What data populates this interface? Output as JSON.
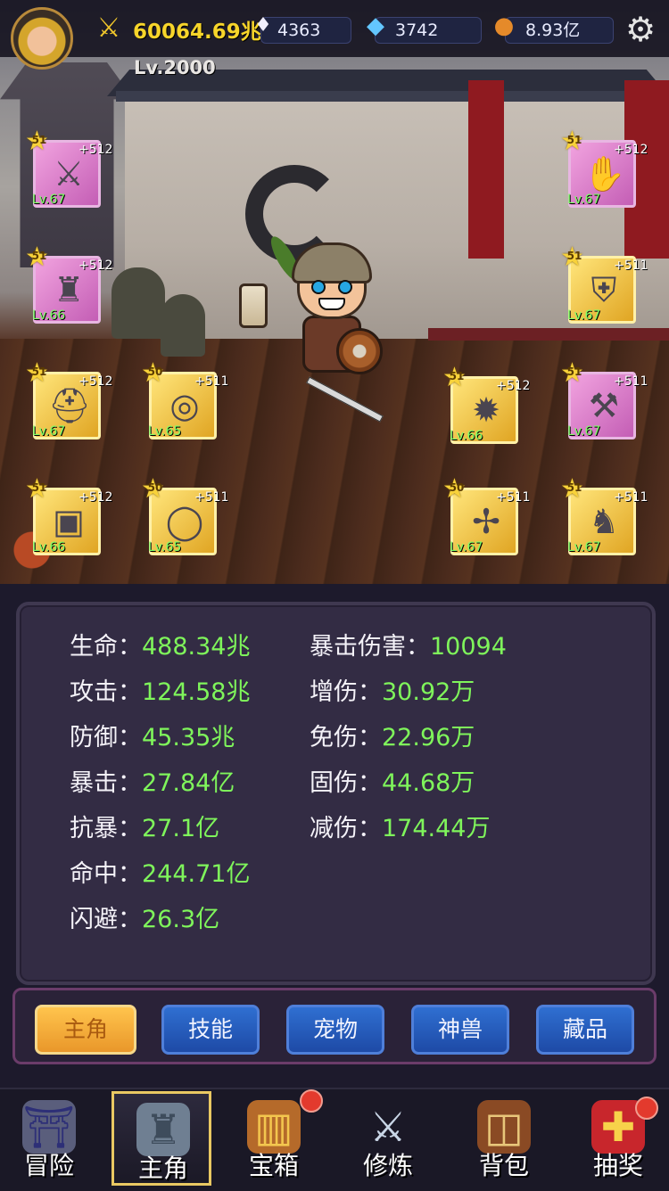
{
  "header": {
    "power": "60064.69兆",
    "level": "Lv.2000",
    "resources": [
      {
        "icon": "crystal-icon",
        "value": "4363"
      },
      {
        "icon": "diamond-icon",
        "value": "3742"
      },
      {
        "icon": "gold-coin-icon",
        "value": "8.93亿"
      }
    ]
  },
  "equipment": [
    {
      "slot": "weapon",
      "stars": "51",
      "plus": "+512",
      "level": "Lv.67",
      "rarity": "purple",
      "icon": "sword-icon"
    },
    {
      "slot": "gauntlet",
      "stars": "51",
      "plus": "+512",
      "level": "Lv.67",
      "rarity": "purple",
      "icon": "gauntlet-icon"
    },
    {
      "slot": "shoulder",
      "stars": "51",
      "plus": "+512",
      "level": "Lv.66",
      "rarity": "purple",
      "icon": "shoulder-armor-icon"
    },
    {
      "slot": "chest",
      "stars": "51",
      "plus": "+511",
      "level": "Lv.67",
      "rarity": "gold",
      "icon": "chest-armor-icon"
    },
    {
      "slot": "helmet",
      "stars": "51",
      "plus": "+512",
      "level": "Lv.67",
      "rarity": "gold",
      "icon": "helmet-icon"
    },
    {
      "slot": "bracelet",
      "stars": "50",
      "plus": "+511",
      "level": "Lv.65",
      "rarity": "gold",
      "icon": "bracelet-icon"
    },
    {
      "slot": "amulet",
      "stars": "51",
      "plus": "+512",
      "level": "Lv.66",
      "rarity": "gold",
      "icon": "amulet-icon"
    },
    {
      "slot": "bracer",
      "stars": "51",
      "plus": "+511",
      "level": "Lv.67",
      "rarity": "purple",
      "icon": "bracer-icon"
    },
    {
      "slot": "belt",
      "stars": "51",
      "plus": "+512",
      "level": "Lv.66",
      "rarity": "gold",
      "icon": "belt-icon"
    },
    {
      "slot": "ring",
      "stars": "50",
      "plus": "+511",
      "level": "Lv.65",
      "rarity": "gold",
      "icon": "ring-icon"
    },
    {
      "slot": "crossbow",
      "stars": "50",
      "plus": "+511",
      "level": "Lv.67",
      "rarity": "gold",
      "icon": "crossbow-icon"
    },
    {
      "slot": "boots",
      "stars": "51",
      "plus": "+511",
      "level": "Lv.67",
      "rarity": "gold",
      "icon": "boots-icon"
    }
  ],
  "stats_left": [
    {
      "label": "生命：",
      "value": "488.34兆"
    },
    {
      "label": "攻击：",
      "value": "124.58兆"
    },
    {
      "label": "防御：",
      "value": "45.35兆"
    },
    {
      "label": "暴击：",
      "value": "27.84亿"
    },
    {
      "label": "抗暴：",
      "value": "27.1亿"
    },
    {
      "label": "命中：",
      "value": "244.71亿"
    },
    {
      "label": "闪避：",
      "value": "26.3亿"
    }
  ],
  "stats_right": [
    {
      "label": "暴击伤害：",
      "value": "10094"
    },
    {
      "label": "增伤：",
      "value": "30.92万"
    },
    {
      "label": "免伤：",
      "value": "22.96万"
    },
    {
      "label": "固伤：",
      "value": "44.68万"
    },
    {
      "label": "减伤：",
      "value": "174.44万"
    }
  ],
  "tabs": [
    "主角",
    "技能",
    "宠物",
    "神兽",
    "藏品"
  ],
  "nav": [
    {
      "label": "冒险",
      "icon": "gate-icon",
      "badge": false
    },
    {
      "label": "主角",
      "icon": "knight-helmet-icon",
      "badge": false
    },
    {
      "label": "宝箱",
      "icon": "treasure-chest-icon",
      "badge": true
    },
    {
      "label": "修炼",
      "icon": "crossed-swords-icon",
      "badge": false
    },
    {
      "label": "背包",
      "icon": "backpack-icon",
      "badge": false
    },
    {
      "label": "抽奖",
      "icon": "gift-box-icon",
      "badge": true
    }
  ],
  "colors": {
    "stat_value": "#7ff55b",
    "power": "#f7d52a",
    "tab_active": "#e9972a",
    "tab_inactive": "#1e4aa6",
    "badge": "#e33a2d"
  }
}
